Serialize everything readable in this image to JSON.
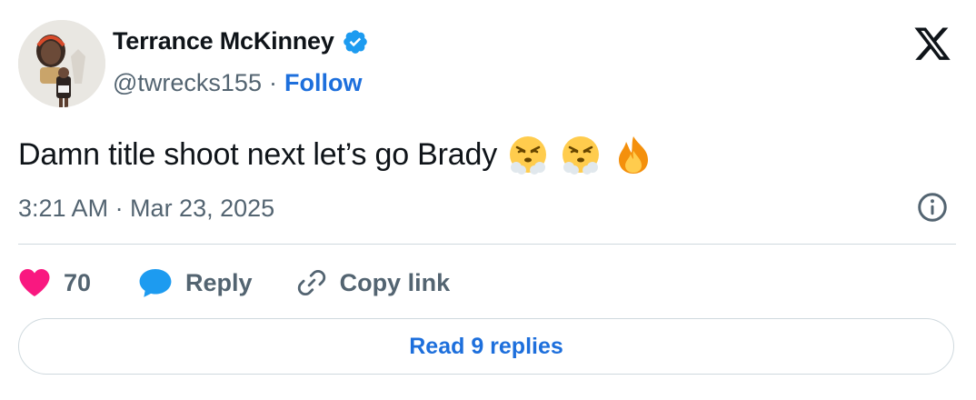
{
  "author": {
    "display_name": "Terrance McKinney",
    "handle": "@twrecks155",
    "separator": "·",
    "follow_label": "Follow"
  },
  "tweet": {
    "text": "Damn title shoot next let’s go Brady",
    "emojis": [
      "face-with-steam-emoji",
      "face-with-steam-emoji",
      "fire-emoji"
    ],
    "timestamp": "3:21 AM · Mar 23, 2025"
  },
  "actions": {
    "like_count": "70",
    "reply_label": "Reply",
    "copy_link_label": "Copy link"
  },
  "footer": {
    "read_replies_label": "Read 9 replies"
  },
  "colors": {
    "link_blue": "#1d6fdc",
    "like_pink": "#f91880",
    "reply_blue": "#1d9bf0",
    "muted_text": "#536471",
    "verified_blue": "#1d9bf0"
  },
  "icons": [
    "verified-badge-icon",
    "x-logo-icon",
    "info-icon",
    "heart-icon",
    "reply-bubble-icon",
    "link-icon"
  ]
}
